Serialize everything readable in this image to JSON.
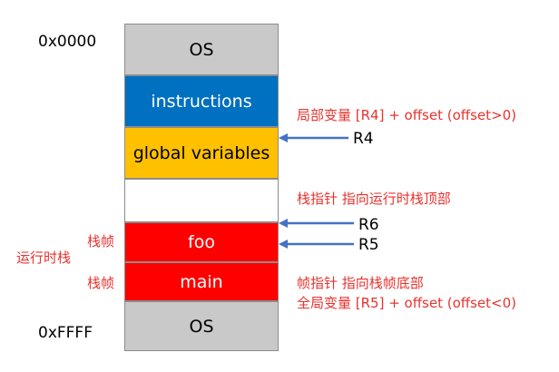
{
  "addresses": {
    "top": "0x0000",
    "bottom": "0xFFFF"
  },
  "segments": [
    {
      "label": "OS",
      "color": "#c9c9c9",
      "text_color": "#000000"
    },
    {
      "label": "instructions",
      "color": "#0070c0",
      "text_color": "#ffffff"
    },
    {
      "label": "global variables",
      "color": "#ffc000",
      "text_color": "#000000"
    },
    {
      "label": "",
      "color": "#ffffff",
      "text_color": "#000000"
    },
    {
      "label": "foo",
      "color": "#ff0000",
      "text_color": "#ffffff"
    },
    {
      "label": "main",
      "color": "#ff0000",
      "text_color": "#ffffff"
    },
    {
      "label": "OS",
      "color": "#c9c9c9",
      "text_color": "#000000"
    }
  ],
  "left_labels": {
    "frame_foo": "栈帧",
    "frame_main": "栈帧",
    "runtime_stack": "运行时栈"
  },
  "annotations": {
    "local_var": "局部变量 [R4] + offset (offset>0)",
    "stack_pointer": "栈指针 指向运行时栈顶部",
    "frame_pointer": "帧指针 指向栈帧底部",
    "global_var": "全局变量 [R5] + offset (offset<0)"
  },
  "registers": {
    "r4": "R4",
    "r6": "R6",
    "r5": "R5"
  },
  "colors": {
    "arrow": "#4472c4",
    "annotation": "#e8332e"
  }
}
